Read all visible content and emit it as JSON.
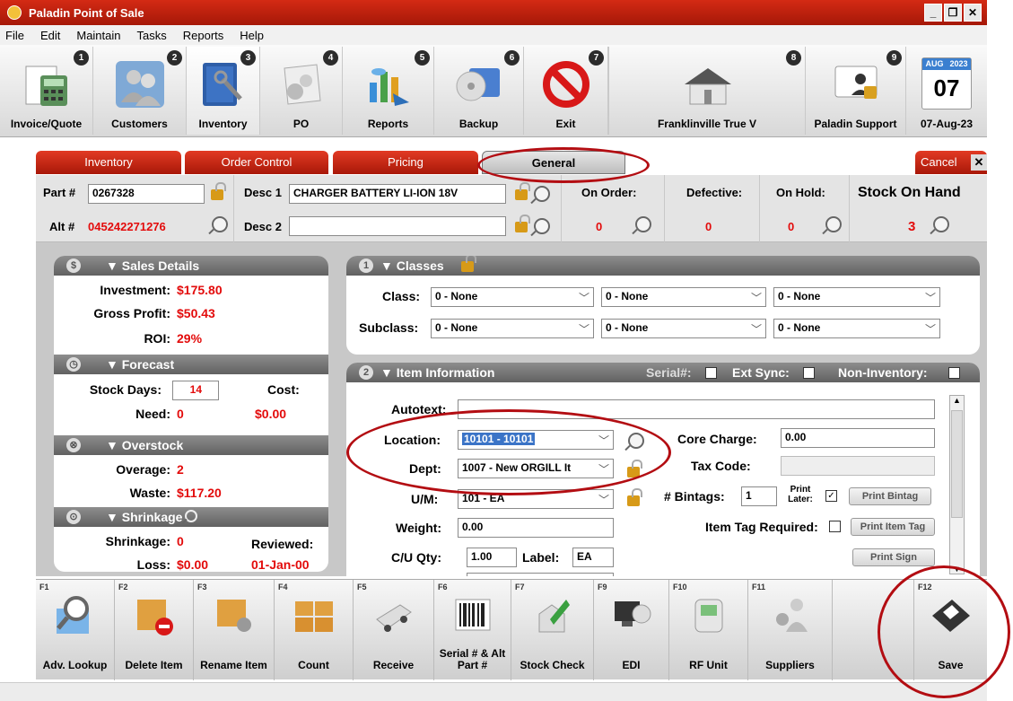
{
  "window": {
    "title": "Paladin Point of Sale"
  },
  "menu": [
    "File",
    "Edit",
    "Maintain",
    "Tasks",
    "Reports",
    "Help"
  ],
  "toolbar": [
    {
      "num": "1",
      "label": "Invoice/Quote",
      "icon": "invoice-icon"
    },
    {
      "num": "2",
      "label": "Customers",
      "icon": "customers-icon"
    },
    {
      "num": "3",
      "label": "Inventory",
      "icon": "inventory-icon"
    },
    {
      "num": "4",
      "label": "PO",
      "icon": "po-icon"
    },
    {
      "num": "5",
      "label": "Reports",
      "icon": "reports-icon"
    },
    {
      "num": "6",
      "label": "Backup",
      "icon": "backup-icon"
    },
    {
      "num": "7",
      "label": "Exit",
      "icon": "exit-icon"
    },
    {
      "num": "8",
      "label": "Franklinville True V",
      "icon": "store-icon"
    },
    {
      "num": "9",
      "label": "Paladin Support",
      "icon": "support-icon"
    }
  ],
  "calendar": {
    "month": "AUG",
    "year": "2023",
    "day": "07",
    "label": "07-Aug-23"
  },
  "tabs": {
    "inventory": "Inventory",
    "order_control": "Order Control",
    "pricing": "Pricing",
    "general": "General",
    "cancel": "Cancel"
  },
  "header": {
    "part_label": "Part #",
    "part_value": "0267328",
    "alt_label": "Alt #",
    "alt_value": "045242271276",
    "desc1_label": "Desc 1",
    "desc1_value": "CHARGER BATTERY LI-ION 18V",
    "desc2_label": "Desc 2",
    "desc2_value": "",
    "on_order_label": "On Order:",
    "on_order_value": "0",
    "defective_label": "Defective:",
    "defective_value": "0",
    "on_hold_label": "On Hold:",
    "on_hold_value": "0",
    "stock_label": "Stock On Hand",
    "stock_value": "3"
  },
  "sales": {
    "title": "Sales Details",
    "investment_label": "Investment:",
    "investment": "$175.80",
    "gp_label": "Gross Profit:",
    "gp": "$50.43",
    "roi_label": "ROI:",
    "roi": "29%"
  },
  "forecast": {
    "title": "Forecast",
    "stock_days_label": "Stock Days:",
    "stock_days": "14",
    "cost_label": "Cost:",
    "need_label": "Need:",
    "need": "0",
    "cost": "$0.00"
  },
  "overstock": {
    "title": "Overstock",
    "overage_label": "Overage:",
    "overage": "2",
    "waste_label": "Waste:",
    "waste": "$117.20"
  },
  "shrinkage": {
    "title": "Shrinkage",
    "shrinkage_label": "Shrinkage:",
    "shrinkage": "0",
    "reviewed_label": "Reviewed:",
    "loss_label": "Loss:",
    "loss": "$0.00",
    "reviewed": "01-Jan-00"
  },
  "classes": {
    "num": "1",
    "title": "Classes",
    "class_label": "Class:",
    "subclass_label": "Subclass:",
    "class_values": [
      "0 - None",
      "0 - None",
      "0 - None"
    ],
    "subclass_values": [
      "0 - None",
      "0 - None",
      "0 - None"
    ]
  },
  "item": {
    "num": "2",
    "title": "Item Information",
    "serial_label": "Serial#:",
    "ext_sync_label": "Ext Sync:",
    "non_inventory_label": "Non-Inventory:",
    "autotext_label": "Autotext:",
    "autotext": "",
    "location_label": "Location:",
    "location": "10101 - 10101",
    "dept_label": "Dept:",
    "dept": "1007 - New ORGILL It",
    "um_label": "U/M:",
    "um": "101 - EA",
    "weight_label": "Weight:",
    "weight": "0.00",
    "cu_qty_label": "C/U Qty:",
    "cu_qty": "1.00",
    "label_label": "Label:",
    "label_value": "EA",
    "core_charge_label": "Core Charge:",
    "core_charge": "0.00",
    "tax_code_label": "Tax Code:",
    "bintags_label": "# Bintags:",
    "bintags": "1",
    "print_later_label": "Print Later:",
    "print_bintag": "Print Bintag",
    "item_tag_label": "Item Tag Required:",
    "print_item_tag": "Print Item Tag",
    "print_sign": "Print Sign"
  },
  "fkeys": [
    {
      "key": "F1",
      "label": "Adv. Lookup",
      "icon": "magnifier-icon"
    },
    {
      "key": "F2",
      "label": "Delete Item",
      "icon": "delete-box-icon"
    },
    {
      "key": "F3",
      "label": "Rename Item",
      "icon": "rename-box-icon"
    },
    {
      "key": "F4",
      "label": "Count",
      "icon": "count-boxes-icon"
    },
    {
      "key": "F5",
      "label": "Receive",
      "icon": "truck-icon"
    },
    {
      "key": "F6",
      "label": "Serial # & Alt Part #",
      "icon": "barcode-icon"
    },
    {
      "key": "F7",
      "label": "Stock Check",
      "icon": "stock-check-icon"
    },
    {
      "key": "F9",
      "label": "EDI",
      "icon": "edi-icon"
    },
    {
      "key": "F10",
      "label": "RF Unit",
      "icon": "rf-unit-icon"
    },
    {
      "key": "F11",
      "label": "Suppliers",
      "icon": "suppliers-icon"
    },
    {
      "key": "F12",
      "label": "Save",
      "icon": "floppy-disk-icon"
    }
  ],
  "colors": {
    "brand_red": "#c41e0e",
    "value_red": "#e30b0b",
    "annotation": "#b30d12"
  }
}
